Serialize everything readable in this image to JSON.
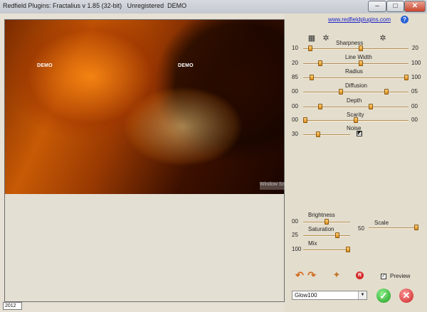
{
  "window": {
    "title": "Redfield Plugins: Fractalius v 1.85 (32-bit)   Unregistered  DEMO",
    "controls": {
      "minimize": "–",
      "maximize": "□",
      "close": "✕"
    }
  },
  "header": {
    "link_text": "www.redfieldplugins.com",
    "help_label": "?"
  },
  "preview": {
    "demo_labels": [
      "DEMO",
      "DEMO"
    ],
    "watermark": "Window Snip"
  },
  "sliders": {
    "sharpness": {
      "label": "Sharpness",
      "left": "10",
      "right": "20",
      "value": 0.05,
      "value2": 0.55
    },
    "line_width": {
      "label": "Line Width",
      "left": "20",
      "right": "100",
      "value": 0.15,
      "value2": 0.55
    },
    "radius": {
      "label": "Radius",
      "left": "85",
      "right": "100",
      "value": 0.06,
      "value2": 1.0
    },
    "diffusion": {
      "label": "Diffusion",
      "left": "00",
      "right": "05",
      "value": 0.35,
      "value2": 0.8
    },
    "depth": {
      "label": "Depth",
      "left": "00",
      "right": "00",
      "value": 0.15,
      "value2": 0.65
    },
    "scarity": {
      "label": "Scarity",
      "left": "00",
      "right": "00",
      "value": 0.0,
      "value2": 0.5
    },
    "noise": {
      "label": "Noise",
      "left": "30",
      "value": 0.3
    }
  },
  "adjust": {
    "brightness": {
      "label": "Brightness",
      "left": "00",
      "value": 0.5
    },
    "saturation": {
      "label": "Saturation",
      "left": "25",
      "value": 0.75
    },
    "mix": {
      "label": "Mix",
      "left": "100",
      "value": 1.0
    },
    "scale": {
      "label": "Scale",
      "left": "50",
      "value": 1.0
    }
  },
  "footer": {
    "preview_label": "Preview",
    "preview_checked": "✓",
    "preset_value": "Glow100",
    "ok_glyph": "✓",
    "cancel_glyph": "✕",
    "status_value": "2012",
    "undo_icon": "↶",
    "redo_icon": "↷",
    "randomize_icon": "✦",
    "reset_icon": "R",
    "grid_icon": "▦",
    "gear_icon_1": "✲",
    "gear_icon_2": "✲"
  }
}
